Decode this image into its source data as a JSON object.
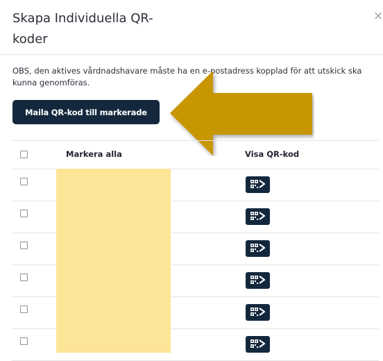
{
  "modal": {
    "title": "Skapa Individuella QR-koder",
    "close_label": "×",
    "notice": "OBS, den aktives vårdnadshavare måste ha en e-postadress kopplad för att utskick ska kunna genomföras.",
    "mail_button_label": "Maila QR-kod till markerade"
  },
  "table": {
    "select_all_label": "Markera alla",
    "qr_column_label": "Visa QR-kod",
    "rows": [
      {},
      {},
      {},
      {},
      {},
      {}
    ]
  },
  "colors": {
    "button_bg": "#13283d",
    "arrow": "#c79600",
    "redaction": "#fde597"
  },
  "icons": {
    "qr": "qr-code-arrow-icon",
    "annotation": "annotation-arrow-icon"
  }
}
